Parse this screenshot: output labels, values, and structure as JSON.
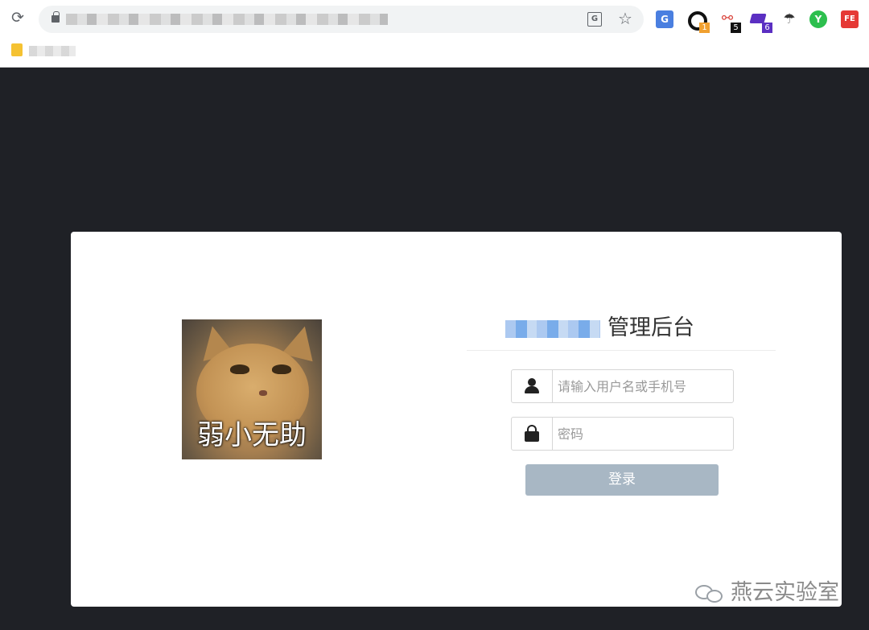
{
  "browser": {
    "reload_glyph": "⟳",
    "star_glyph": "☆",
    "translate_glyph": "G",
    "extensions": [
      {
        "icon": "google-translate-icon",
        "label": "G"
      },
      {
        "icon": "ring-icon",
        "badge": "1",
        "badge_color": "#f0a030"
      },
      {
        "icon": "chain-link-icon",
        "label": "⚯",
        "badge": "5",
        "badge_color": "#111111"
      },
      {
        "icon": "graduation-cap-icon",
        "badge": "6",
        "badge_color": "#5b2fc2"
      },
      {
        "icon": "umbrella-icon",
        "label": "☂"
      },
      {
        "icon": "y-icon",
        "label": "Y"
      },
      {
        "icon": "fe-icon",
        "label": "FE"
      }
    ]
  },
  "login": {
    "illustration_caption": "弱小无助",
    "title_suffix": "管理后台",
    "username_placeholder": "请输入用户名或手机号",
    "password_placeholder": "密码",
    "submit_label": "登录"
  },
  "watermark": {
    "text": "燕云实验室"
  },
  "colors": {
    "page_background": "#1f2126",
    "card_background": "#ffffff",
    "button_background": "#a8b7c4",
    "button_text": "#ffffff"
  }
}
